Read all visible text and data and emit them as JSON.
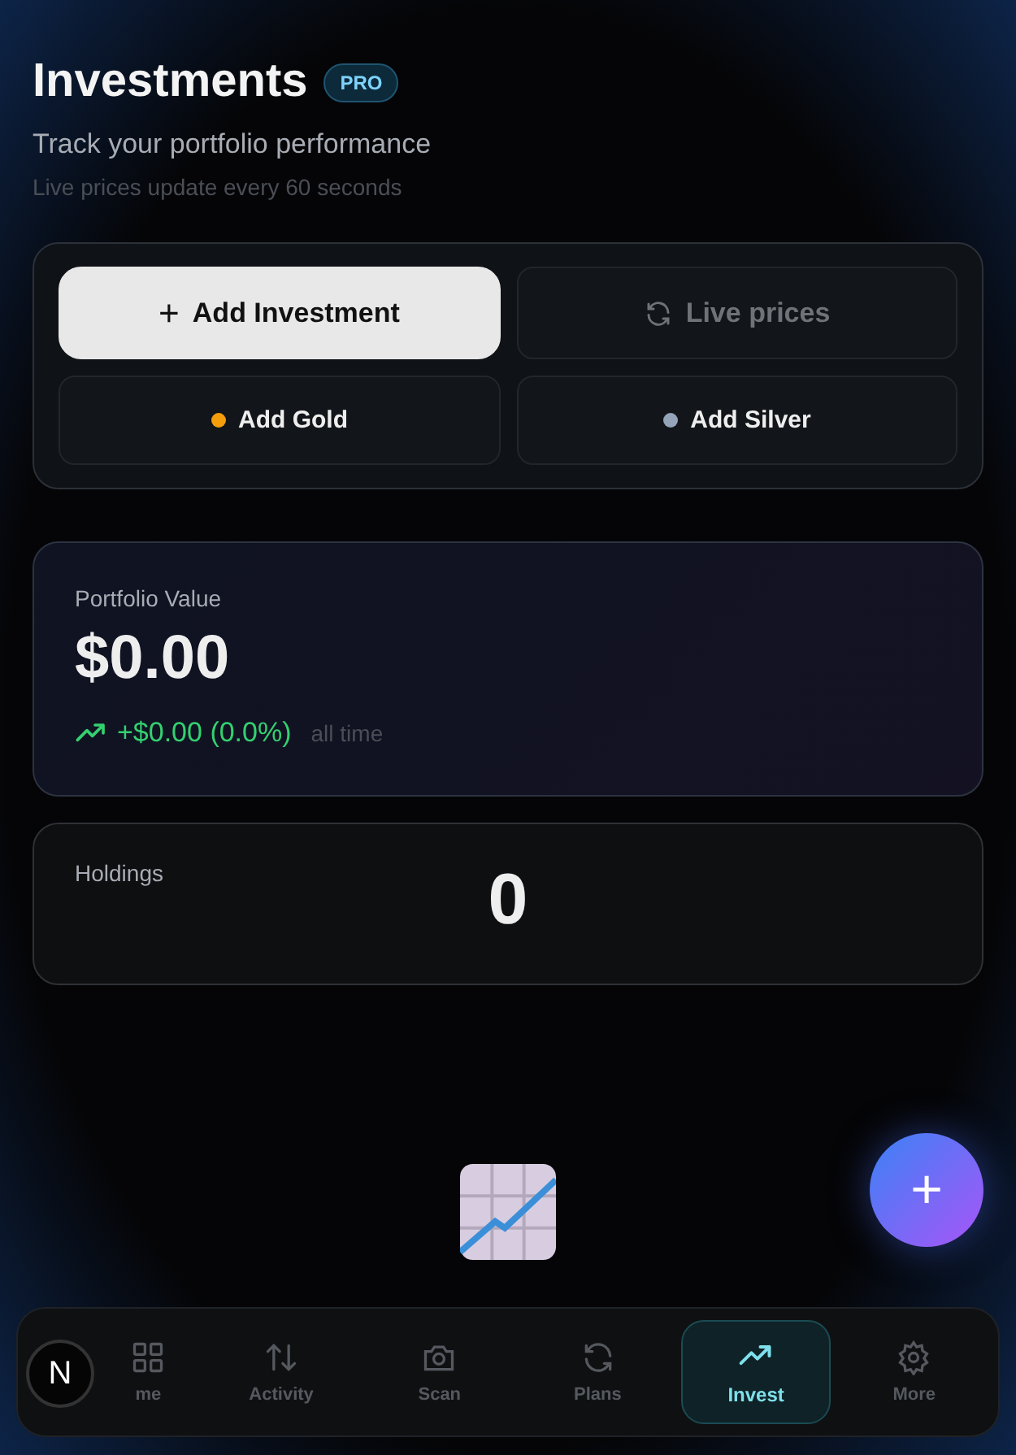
{
  "header": {
    "title": "Investments",
    "badge": "PRO",
    "subtitle": "Track your portfolio performance",
    "note": "Live prices update every 60 seconds"
  },
  "actions": [
    {
      "kind": "primary",
      "icon": "+",
      "label": "Add Investment",
      "disabled": false
    },
    {
      "kind": "refresh",
      "label": "Live prices",
      "disabled": true
    },
    {
      "kind": "metal",
      "label": "Add Gold",
      "color": "#f59e0b",
      "disabled": false
    },
    {
      "kind": "metal",
      "label": "Add Silver",
      "color": "#94a3b8",
      "disabled": false
    }
  ],
  "portfolio": {
    "label": "Portfolio Value",
    "value": "$0.00",
    "change": "+$0.00 (0.0%)",
    "period": "all time"
  },
  "holdings": {
    "label": "Holdings",
    "value": "0"
  },
  "fab": {
    "icon": "+"
  },
  "badge": {
    "letter": "N"
  },
  "nav": [
    {
      "label": "me",
      "selected": false
    },
    {
      "label": "Activity",
      "selected": false
    },
    {
      "label": "Scan",
      "selected": false
    },
    {
      "label": "Plans",
      "selected": false
    },
    {
      "label": "Invest",
      "selected": true
    },
    {
      "label": "More",
      "selected": false
    }
  ]
}
